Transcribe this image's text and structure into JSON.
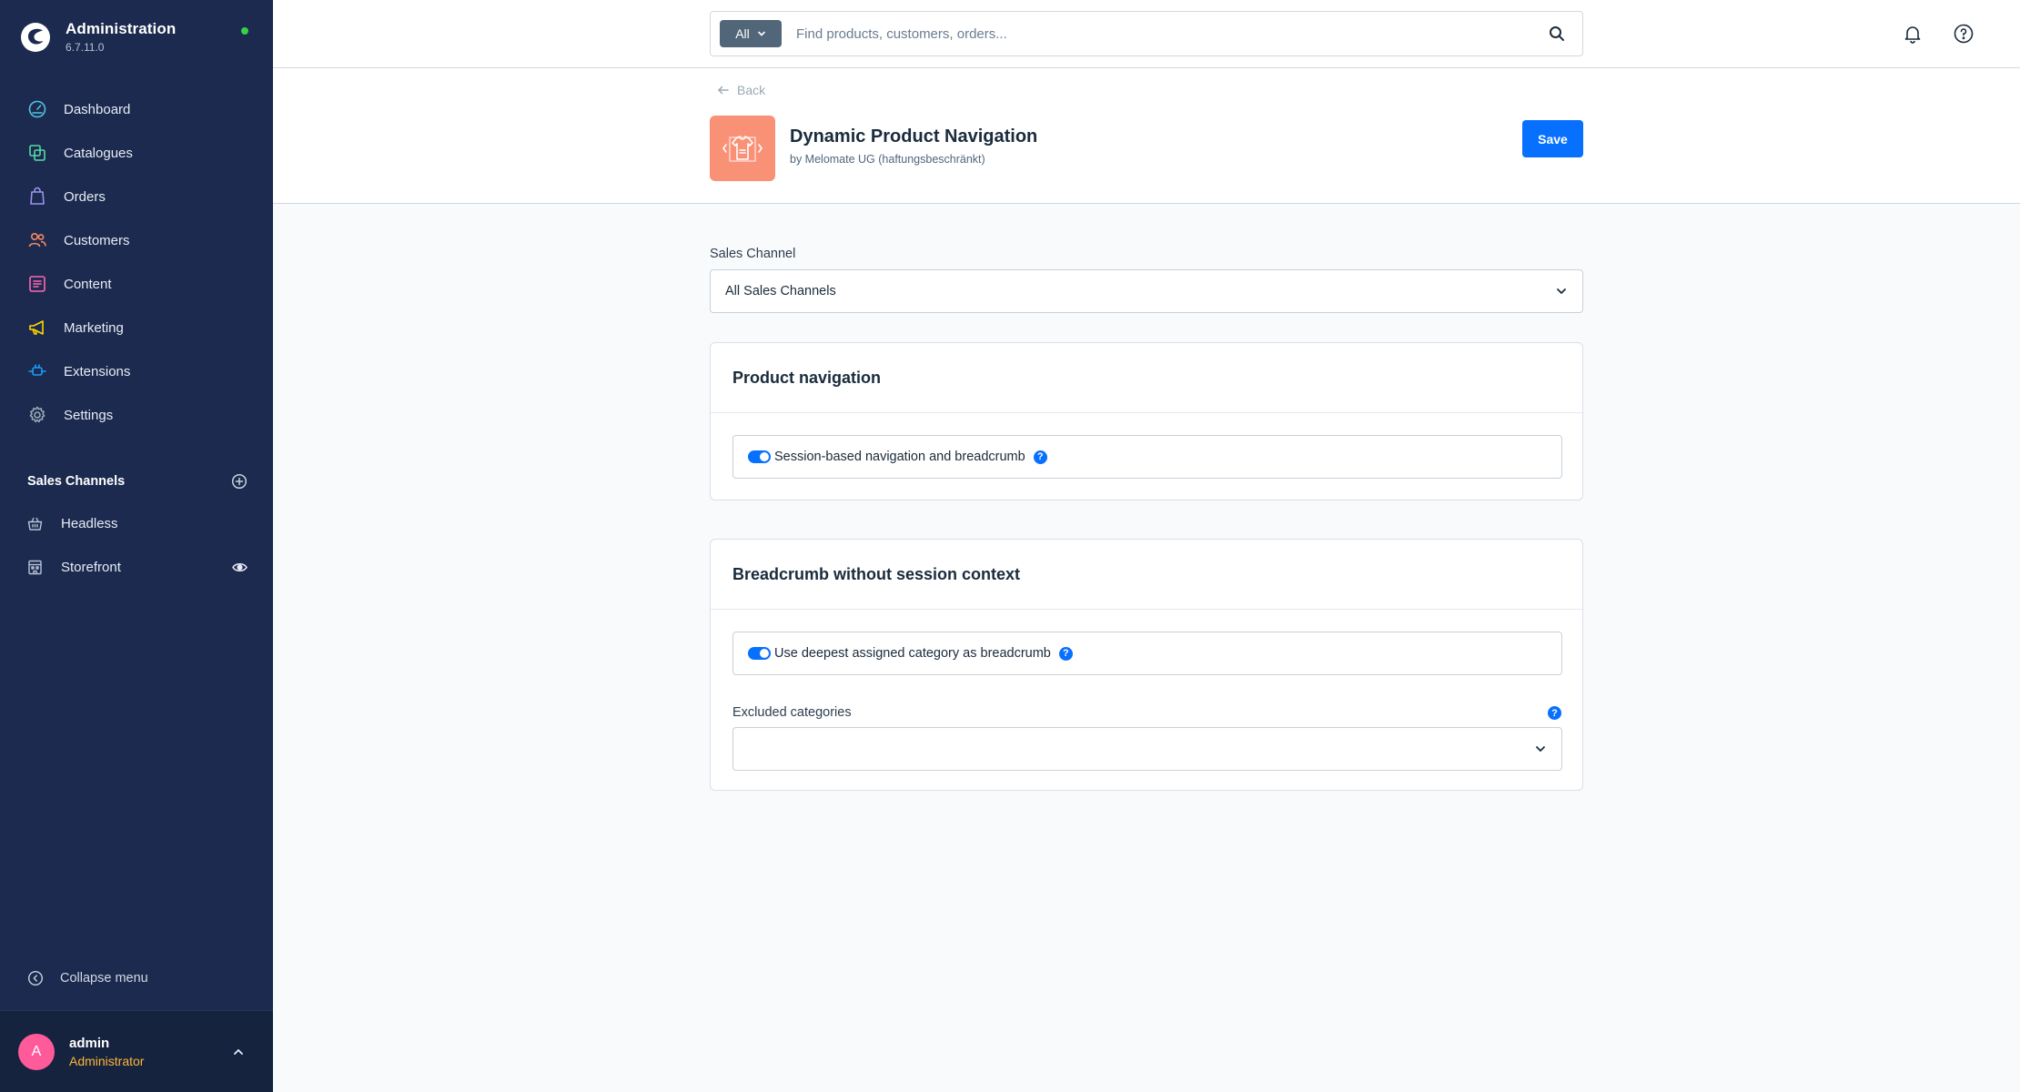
{
  "app": {
    "title": "Administration",
    "version": "6.7.11.0",
    "status_color": "#37d046"
  },
  "sidebar": {
    "items": [
      {
        "label": "Dashboard",
        "icon": "dashboard-gauge-icon",
        "color": "#4fc4e0"
      },
      {
        "label": "Catalogues",
        "icon": "catalogue-icon",
        "color": "#57d9a3"
      },
      {
        "label": "Orders",
        "icon": "shopping-bag-icon",
        "color": "#a092f0"
      },
      {
        "label": "Customers",
        "icon": "users-icon",
        "color": "#f88962"
      },
      {
        "label": "Content",
        "icon": "content-list-icon",
        "color": "#ff68b4"
      },
      {
        "label": "Marketing",
        "icon": "megaphone-icon",
        "color": "#ffd700"
      },
      {
        "label": "Extensions",
        "icon": "plug-icon",
        "color": "#189eff"
      },
      {
        "label": "Settings",
        "icon": "gear-icon",
        "color": "#9aa8b5"
      }
    ],
    "sales_channels": {
      "title": "Sales Channels",
      "items": [
        {
          "label": "Headless",
          "icon": "basket-icon"
        },
        {
          "label": "Storefront",
          "icon": "storefront-icon"
        }
      ]
    },
    "collapse_label": "Collapse menu",
    "user": {
      "initial": "A",
      "name": "admin",
      "role": "Administrator"
    }
  },
  "search": {
    "type_label": "All",
    "placeholder": "Find products, customers, orders..."
  },
  "header": {
    "back_label": "Back",
    "plugin_name": "Dynamic Product Navigation",
    "plugin_author": "by Melomate UG (haftungsbeschränkt)",
    "save_label": "Save",
    "accent_color": "#0870ff"
  },
  "config": {
    "sales_channel_label": "Sales Channel",
    "sales_channel_value": "All Sales Channels",
    "cards": [
      {
        "title": "Product navigation",
        "toggle_label": "Session-based navigation and breadcrumb",
        "toggle_on": true
      },
      {
        "title": "Breadcrumb without session context",
        "toggle_label": "Use deepest assigned category as breadcrumb",
        "toggle_on": true,
        "excluded_label": "Excluded categories",
        "excluded_value": ""
      }
    ]
  }
}
